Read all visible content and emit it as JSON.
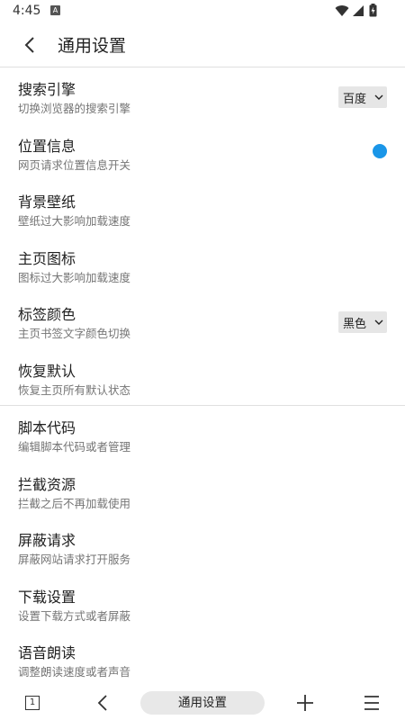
{
  "status_bar": {
    "time": "4:45",
    "notification_glyph": "A"
  },
  "header": {
    "title": "通用设置"
  },
  "settings": [
    {
      "title": "搜索引擎",
      "subtitle": "切换浏览器的搜索引擎",
      "control": "select",
      "value": "百度"
    },
    {
      "title": "位置信息",
      "subtitle": "网页请求位置信息开关",
      "control": "toggle",
      "toggle_on": true
    },
    {
      "title": "背景壁纸",
      "subtitle": "壁纸过大影响加载速度"
    },
    {
      "title": "主页图标",
      "subtitle": "图标过大影响加载速度"
    },
    {
      "title": "标签颜色",
      "subtitle": "主页书签文字颜色切换",
      "control": "select",
      "value": "黑色"
    },
    {
      "title": "恢复默认",
      "subtitle": "恢复主页所有默认状态"
    },
    {
      "title": "脚本代码",
      "subtitle": "编辑脚本代码或者管理"
    },
    {
      "title": "拦截资源",
      "subtitle": "拦截之后不再加载使用"
    },
    {
      "title": "屏蔽请求",
      "subtitle": "屏蔽网站请求打开服务"
    },
    {
      "title": "下载设置",
      "subtitle": "设置下载方式或者屏蔽"
    },
    {
      "title": "语音朗读",
      "subtitle": "调整朗读速度或者声音"
    }
  ],
  "bottom_bar": {
    "tab_count": "1",
    "url_label": "通用设置"
  },
  "icons": {
    "back": "back-arrow-icon",
    "tabs": "tabs-icon",
    "nav_back": "chevron-left-icon",
    "add": "plus-icon",
    "menu": "hamburger-menu-icon",
    "dropdown": "chevron-down-icon"
  },
  "colors": {
    "toggle_accent": "#1a96e8"
  }
}
